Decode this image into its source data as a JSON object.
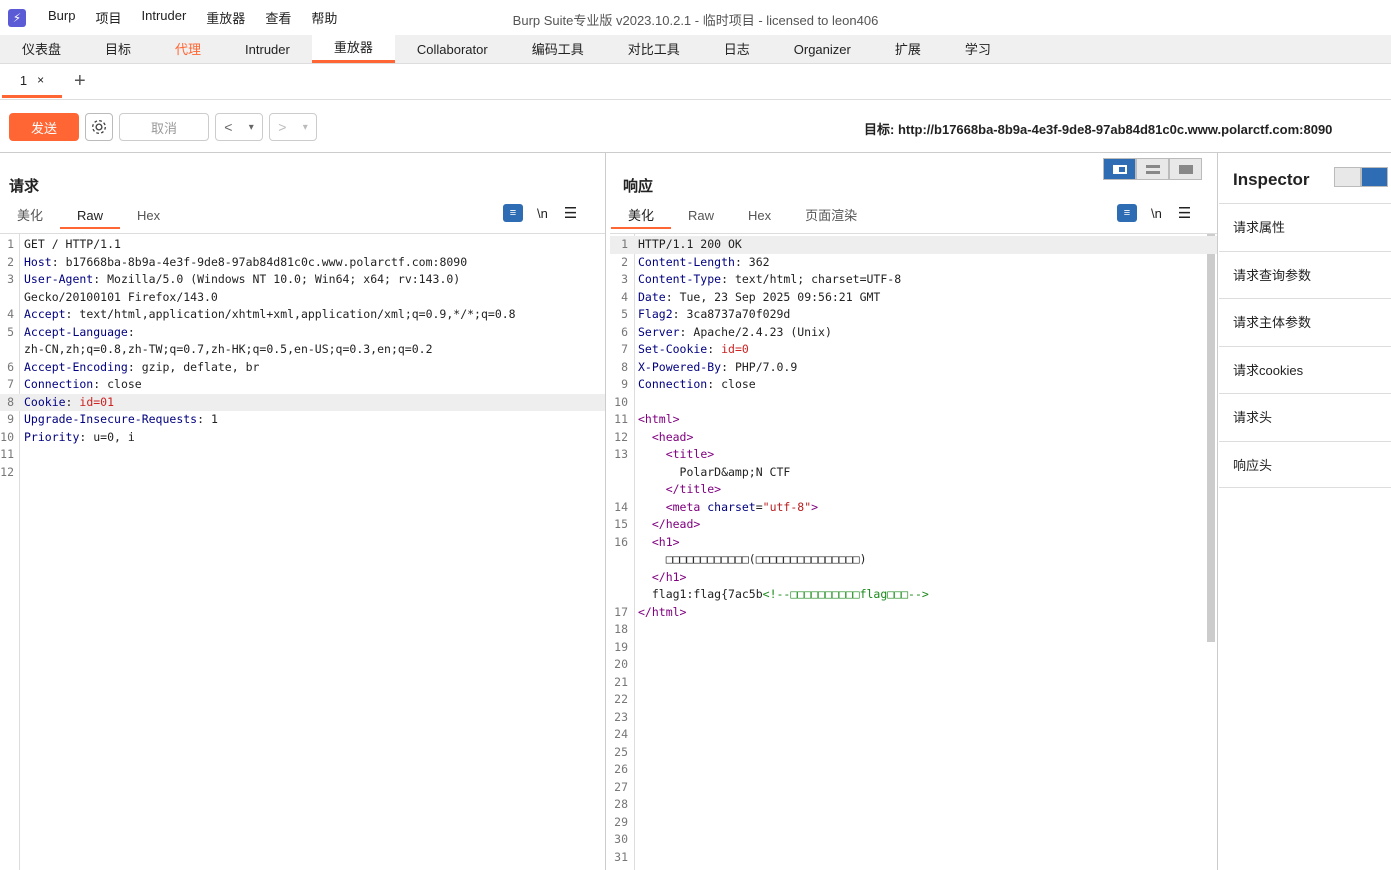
{
  "app": {
    "window_title": "Burp Suite专业版  v2023.10.2.1 - 临时项目 - licensed to leon406",
    "menu": [
      "Burp",
      "项目",
      "Intruder",
      "重放器",
      "查看",
      "帮助"
    ]
  },
  "main_tabs": [
    {
      "label": "仪表盘"
    },
    {
      "label": "目标"
    },
    {
      "label": "代理"
    },
    {
      "label": "Intruder"
    },
    {
      "label": "重放器"
    },
    {
      "label": "Collaborator"
    },
    {
      "label": "编码工具"
    },
    {
      "label": "对比工具"
    },
    {
      "label": "日志"
    },
    {
      "label": "Organizer"
    },
    {
      "label": "扩展"
    },
    {
      "label": "学习"
    }
  ],
  "repeater": {
    "tab_label": "1",
    "tab_close": "×",
    "add_tab": "+",
    "send_label": "发送",
    "cancel_label": "取消",
    "back_label": "<",
    "forward_label": ">",
    "dropdown_glyph": "▾",
    "target_label": "目标: http://b17668ba-8b9a-4e3f-9de8-97ab84d81c0c.www.polarctf.com:8090"
  },
  "request": {
    "title": "请求",
    "view_tabs": [
      "美化",
      "Raw",
      "Hex"
    ],
    "active_view": "Raw",
    "newline_label": "\\n",
    "lines": [
      {
        "n": "1",
        "k": "",
        "v": "GET / HTTP/1.1"
      },
      {
        "n": "2",
        "k": "Host",
        "v": " b17668ba-8b9a-4e3f-9de8-97ab84d81c0c.www.polarctf.com:8090"
      },
      {
        "n": "3",
        "k": "User-Agent",
        "v": " Mozilla/5.0 (Windows NT 10.0; Win64; x64; rv:143.0)"
      },
      {
        "n": "",
        "k": "",
        "v": "Gecko/20100101 Firefox/143.0"
      },
      {
        "n": "4",
        "k": "Accept",
        "v": " text/html,application/xhtml+xml,application/xml;q=0.9,*/*;q=0.8"
      },
      {
        "n": "5",
        "k": "Accept-Language",
        "v": ""
      },
      {
        "n": "",
        "k": "",
        "v": "zh-CN,zh;q=0.8,zh-TW;q=0.7,zh-HK;q=0.5,en-US;q=0.3,en;q=0.2"
      },
      {
        "n": "6",
        "k": "Accept-Encoding",
        "v": " gzip, deflate, br"
      },
      {
        "n": "7",
        "k": "Connection",
        "v": " close"
      },
      {
        "n": "8",
        "k": "Cookie",
        "v": " id=01"
      },
      {
        "n": "9",
        "k": "Upgrade-Insecure-Requests",
        "v": " 1"
      },
      {
        "n": "10",
        "k": "Priority",
        "v": " u=0, i"
      },
      {
        "n": "11",
        "k": "",
        "v": ""
      },
      {
        "n": "12",
        "k": "",
        "v": ""
      }
    ]
  },
  "response": {
    "title": "响应",
    "view_tabs": [
      "美化",
      "Raw",
      "Hex",
      "页面渲染"
    ],
    "active_view": "美化",
    "newline_label": "\\n",
    "header_lines": [
      {
        "n": "1",
        "k": "",
        "v": "HTTP/1.1 200 OK"
      },
      {
        "n": "2",
        "k": "Content-Length",
        "v": " 362"
      },
      {
        "n": "3",
        "k": "Content-Type",
        "v": " text/html; charset=UTF-8"
      },
      {
        "n": "4",
        "k": "Date",
        "v": " Tue, 23 Sep 2025 09:56:21 GMT"
      },
      {
        "n": "5",
        "k": "Flag2",
        "v": " 3ca8737a70f029d"
      },
      {
        "n": "6",
        "k": "Server",
        "v": " Apache/2.4.23 (Unix)"
      },
      {
        "n": "7",
        "k": "Set-Cookie",
        "v": " id=0"
      },
      {
        "n": "8",
        "k": "X-Powered-By",
        "v": " PHP/7.0.9"
      },
      {
        "n": "9",
        "k": "Connection",
        "v": " close"
      },
      {
        "n": "10",
        "k": "",
        "v": ""
      }
    ],
    "html_lines": [
      {
        "n": "11",
        "indent": "",
        "open": "<html>"
      },
      {
        "n": "12",
        "indent": "  ",
        "open": "<head>"
      },
      {
        "n": "13",
        "indent": "    ",
        "open": "<title>"
      },
      {
        "n": "",
        "indent": "      ",
        "text": "PolarD&amp;N CTF"
      },
      {
        "n": "",
        "indent": "    ",
        "open": "</title>"
      },
      {
        "n": "14",
        "indent": "    ",
        "meta": true
      },
      {
        "n": "15",
        "indent": "  ",
        "open": "</head>"
      },
      {
        "n": "16",
        "indent": "  ",
        "open": "<h1>"
      },
      {
        "n": "",
        "indent": "    ",
        "text": "□□□□□□□□□□□□(□□□□□□□□□□□□□□□)"
      },
      {
        "n": "",
        "indent": "  ",
        "open": "</h1>"
      },
      {
        "n": "",
        "indent": "  ",
        "flag": true
      },
      {
        "n": "17",
        "indent": "",
        "open": "</html>"
      }
    ],
    "meta_tag": "<meta",
    "meta_attr": " charset",
    "meta_eq": "=",
    "meta_val": "\"utf-8\"",
    "meta_close": ">",
    "flag_text": "flag1:flag{7ac5b",
    "flag_comment": "<!--□□□□□□□□□□flag□□□-->",
    "trailing_line_numbers": [
      "18",
      "19",
      "20",
      "21",
      "22",
      "23",
      "24",
      "25",
      "26",
      "27",
      "28",
      "29",
      "30",
      "31"
    ]
  },
  "inspector": {
    "title": "Inspector",
    "items": [
      "请求属性",
      "请求查询参数",
      "请求主体参数",
      "请求cookies",
      "请求头",
      "响应头"
    ]
  },
  "colors": {
    "accent": "#ff6633",
    "blue": "#2e6db4"
  }
}
